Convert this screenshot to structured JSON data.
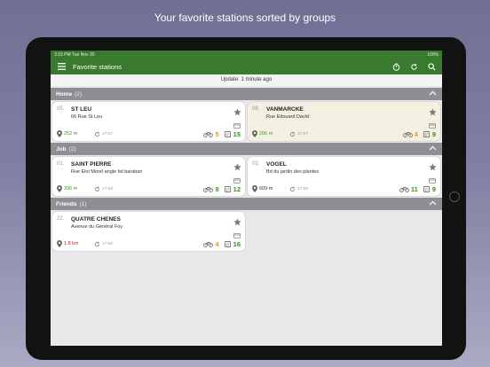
{
  "caption": "Your favorite stations sorted by groups",
  "statusbar": {
    "left": "3:15 PM   Tue Nov 30",
    "right": "100%"
  },
  "appbar": {
    "title": "Favorite stations"
  },
  "update_text": "Update: 1 minute ago",
  "colors": {
    "primary": "#3a7a2e",
    "group_header": "#8e8e93",
    "highlight": "#f3f0e2"
  },
  "groups": [
    {
      "name": "Home",
      "count": "(2)",
      "stations": [
        {
          "num": "05.",
          "name": "ST LEU",
          "address": "66 Rue St Leu",
          "distance": "252 m",
          "distance_color": "green",
          "time": "17:07",
          "bikes": "5",
          "bikes_color": "orange",
          "stands": "15",
          "highlight": false
        },
        {
          "num": "08.",
          "name": "VANMARCKE",
          "address": "Rue Edouard David",
          "distance": "206 m",
          "distance_color": "green",
          "time": "17:07",
          "bikes": "4",
          "bikes_color": "orange",
          "stands": "9",
          "highlight": true
        }
      ]
    },
    {
      "name": "Job",
      "count": "(2)",
      "stations": [
        {
          "num": "01.",
          "name": "SAINT PIERRE",
          "address": "Rue Eloi Morel angle bd baraban",
          "distance": "396 m",
          "distance_color": "green",
          "time": "17:06",
          "bikes": "8",
          "bikes_color": "green",
          "stands": "12",
          "highlight": false
        },
        {
          "num": "03.",
          "name": "VOGEL",
          "address": "Bd du jardin des plantes",
          "distance": "609 m",
          "distance_color": "dark",
          "time": "17:05",
          "bikes": "11",
          "bikes_color": "green",
          "stands": "9",
          "highlight": false
        }
      ]
    },
    {
      "name": "Friends",
      "count": "(1)",
      "stations": [
        {
          "num": "22.",
          "name": "QUATRE CHENES",
          "address": "Avenue du Général Foy",
          "distance": "1.8 km",
          "distance_color": "red",
          "time": "17:05",
          "bikes": "4",
          "bikes_color": "orange",
          "stands": "16",
          "highlight": false
        }
      ]
    }
  ]
}
